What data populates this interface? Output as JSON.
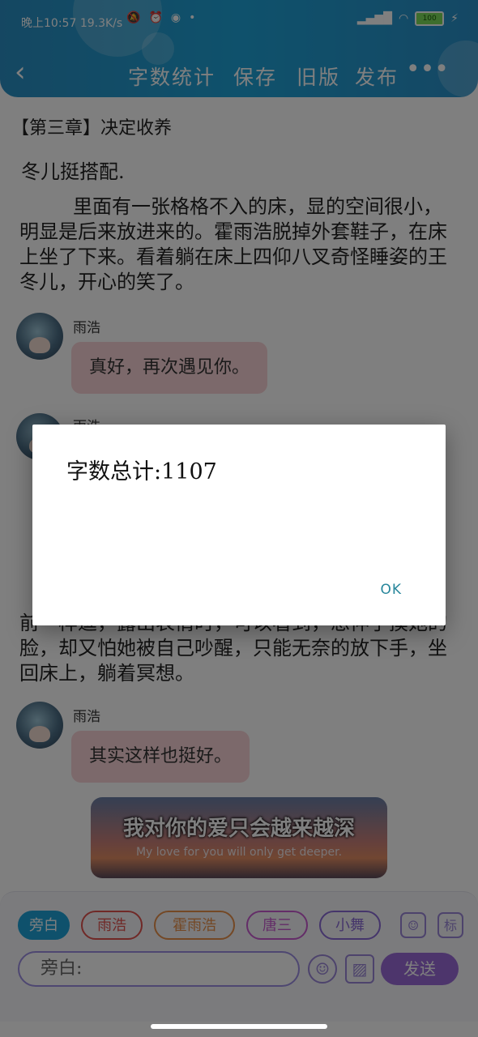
{
  "status_bar": {
    "time": "晚上10:57",
    "speed": "19.3K/s",
    "battery": "100"
  },
  "toolbar": {
    "back_label": "‹",
    "items": [
      "字数统计",
      "保存",
      "旧版",
      "发布"
    ],
    "more_label": "•••"
  },
  "content": {
    "chapter_title": "【第三章】决定收养",
    "p1": "冬儿挺搭配.",
    "p2": "里面有一张格格不入的床，显的空间很小，明显是后来放进来的。霍雨浩脱掉外套鞋子，在床上坐了下来。看着躺在床上四仰八叉奇怪睡姿的王冬儿，开心的笑了。",
    "p3": "前一样逗，露出表情时，可以看到，想伸手摸她的脸，却又怕她被自己吵醒，只能无奈的放下手，坐回床上，躺着冥想。",
    "messages": [
      {
        "speaker": "雨浩",
        "text": "真好，再次遇见你。"
      },
      {
        "speaker": "雨浩",
        "text": ""
      },
      {
        "speaker": "雨浩",
        "text": "其实这样也挺好。"
      }
    ],
    "banner_zh": "我对你的爱只会越来越深",
    "banner_en": "My love for you will only get deeper."
  },
  "bottom_bar": {
    "chips": [
      "旁白",
      "雨浩",
      "霍雨浩",
      "唐三",
      "小舞"
    ],
    "mark_label": "标",
    "input_placeholder": "旁白:",
    "send_label": "发送"
  },
  "dialog": {
    "message": "字数总计:1107",
    "ok_label": "OK"
  },
  "colors": {
    "header": "#1ea3d8",
    "bubble": "#f8d3d6",
    "send": "#9b6ad8",
    "accent": "#27869b"
  }
}
